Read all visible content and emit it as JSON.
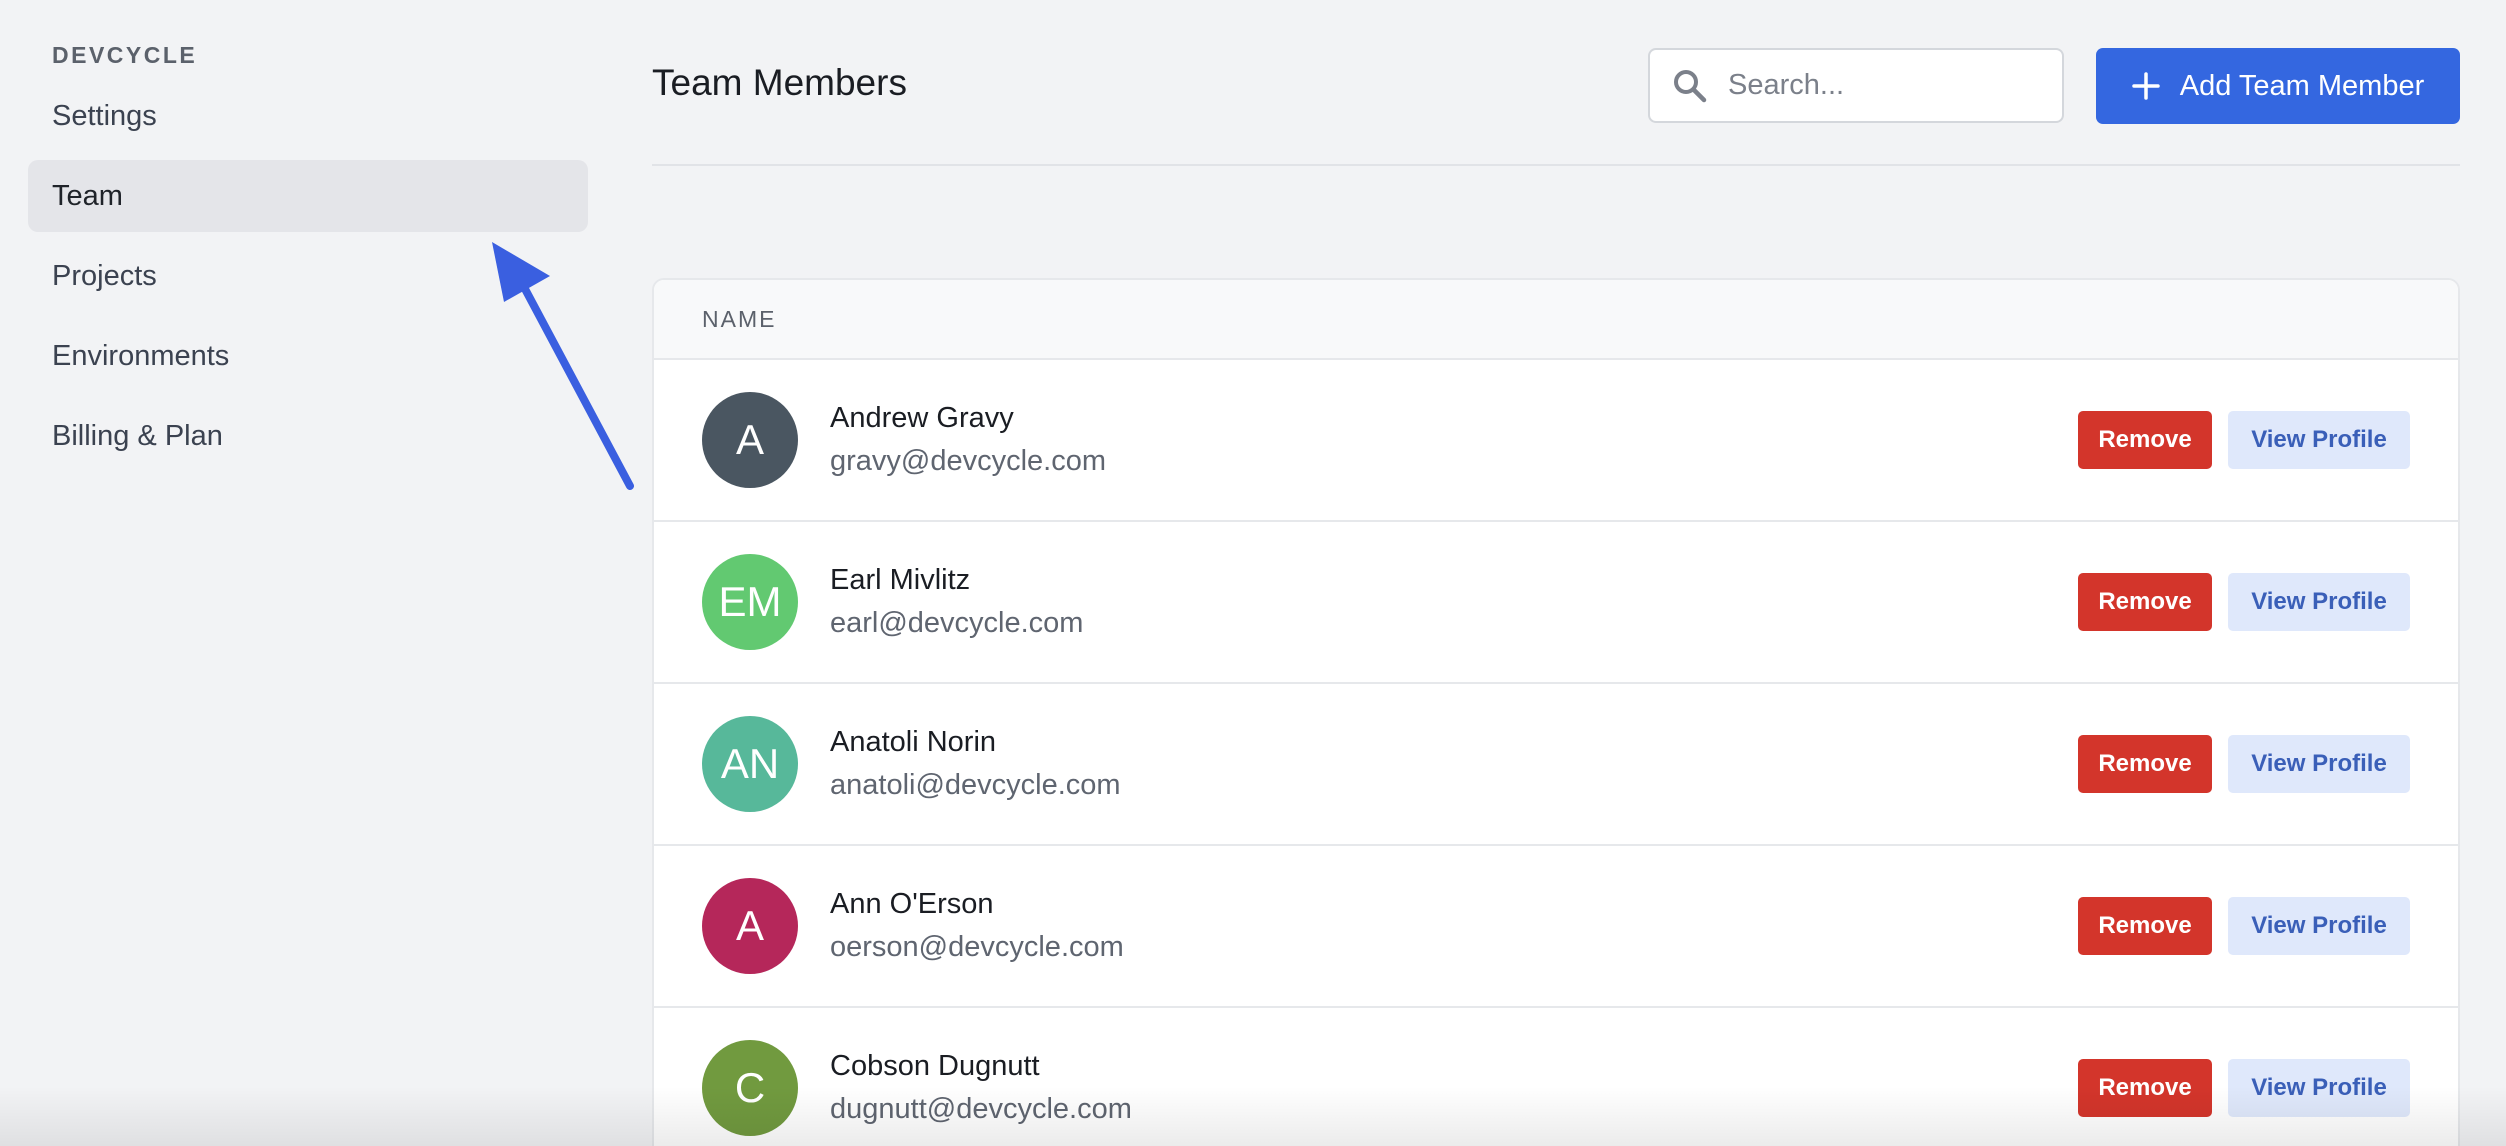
{
  "sidebar": {
    "brand": "DEVCYCLE",
    "items": [
      {
        "label": "Settings",
        "active": false
      },
      {
        "label": "Team",
        "active": true
      },
      {
        "label": "Projects",
        "active": false
      },
      {
        "label": "Environments",
        "active": false
      },
      {
        "label": "Billing & Plan",
        "active": false
      }
    ]
  },
  "header": {
    "title": "Team Members",
    "search_placeholder": "Search...",
    "add_label": "Add Team Member"
  },
  "table": {
    "column_name": "NAME",
    "remove_label": "Remove",
    "view_label": "View Profile",
    "rows": [
      {
        "initials": "A",
        "name": "Andrew Gravy",
        "email": "gravy@devcycle.com",
        "color": "#4a5661"
      },
      {
        "initials": "EM",
        "name": "Earl Mivlitz",
        "email": "earl@devcycle.com",
        "color": "#62c971"
      },
      {
        "initials": "AN",
        "name": "Anatoli Norin",
        "email": "anatoli@devcycle.com",
        "color": "#57b89a"
      },
      {
        "initials": "A",
        "name": "Ann O'Erson",
        "email": "oerson@devcycle.com",
        "color": "#b5275a"
      },
      {
        "initials": "C",
        "name": "Cobson Dugnutt",
        "email": "dugnutt@devcycle.com",
        "color": "#719a3f"
      }
    ]
  },
  "colors": {
    "primary": "#3467e0",
    "danger": "#d3352b",
    "annotation_arrow": "#3a5fe0"
  },
  "icons": {
    "search": "search-icon",
    "add": "plus-icon",
    "annotation": "arrow-annotation"
  }
}
